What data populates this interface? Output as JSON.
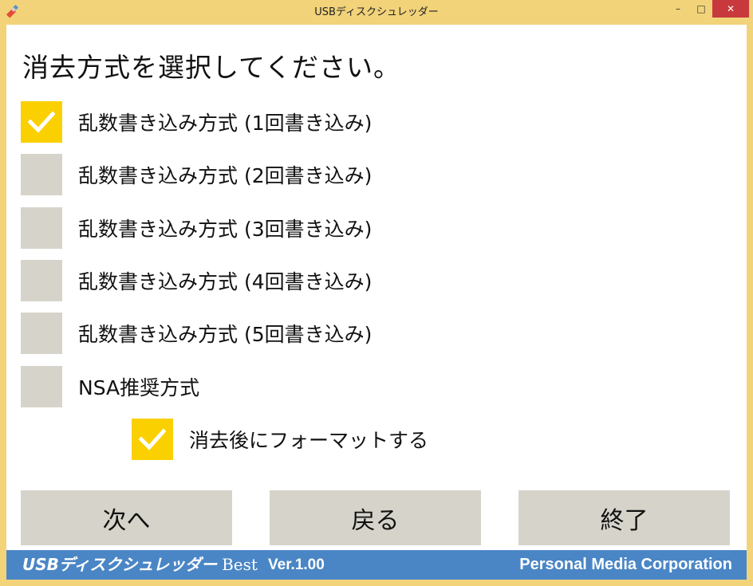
{
  "window": {
    "title": "USBディスクシュレッダー",
    "minimize_glyph": "–",
    "maximize_glyph": "□",
    "close_glyph": "✕"
  },
  "heading": "消去方式を選択してください。",
  "options": [
    {
      "label": "乱数書き込み方式 (1回書き込み)",
      "checked": true
    },
    {
      "label": "乱数書き込み方式 (2回書き込み)",
      "checked": false
    },
    {
      "label": "乱数書き込み方式 (3回書き込み)",
      "checked": false
    },
    {
      "label": "乱数書き込み方式 (4回書き込み)",
      "checked": false
    },
    {
      "label": "乱数書き込み方式 (5回書き込み)",
      "checked": false
    },
    {
      "label": "NSA推奨方式",
      "checked": false
    }
  ],
  "format_after": {
    "label": "消去後にフォーマットする",
    "checked": true
  },
  "buttons": {
    "next": "次へ",
    "back": "戻る",
    "exit": "終了"
  },
  "footer": {
    "brand": "USBディスクシュレッダー",
    "edition": "Best",
    "version": "Ver.1.00",
    "company": "Personal Media Corporation"
  },
  "colors": {
    "frame": "#f2d37a",
    "checked": "#fbd000",
    "unchecked": "#d6d4ca",
    "footer": "#4a86c5",
    "close": "#c7393c"
  }
}
